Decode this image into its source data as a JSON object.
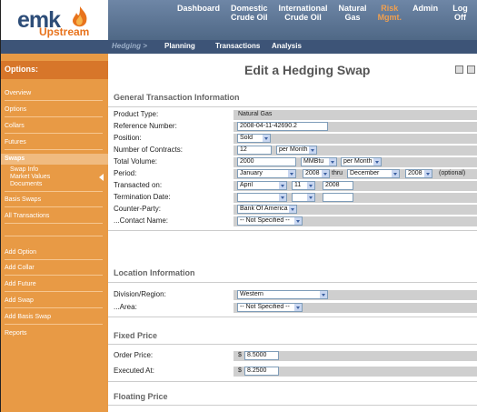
{
  "brand": {
    "name": "emk",
    "sub": "Upstream"
  },
  "topnav": [
    "Dashboard",
    "Domestic\nCrude Oil",
    "International\nCrude Oil",
    "Natural\nGas",
    "Risk\nMgmt.",
    "Admin",
    "Log Off"
  ],
  "subnav": {
    "hedging": "Hedging >",
    "planning": "Planning",
    "transactions": "Transactions",
    "analysis": "Analysis"
  },
  "sidebar": {
    "heading": "Options:",
    "items": [
      "Overview",
      "Options",
      "Collars",
      "Futures",
      "Swaps"
    ],
    "swaps_sub": [
      "Swap Info",
      "Market Values",
      "Documents"
    ],
    "items2": [
      "Basis Swaps",
      "All Transactions"
    ],
    "actions": [
      "Add Option",
      "Add Collar",
      "Add Future",
      "Add Swap",
      "Add Basis Swap",
      "Reports"
    ]
  },
  "page": {
    "title": "Edit a Hedging Swap"
  },
  "general": {
    "heading": "General Transaction Information",
    "product_type_label": "Product Type:",
    "product_type": "Natural Gas",
    "ref_label": "Reference Number:",
    "ref": "2008-04-11-42690.2",
    "position_label": "Position:",
    "position": "Sold",
    "contracts_label": "Number of Contracts:",
    "contracts": "12",
    "contracts_unit": "per Month",
    "volume_label": "Total Volume:",
    "volume": "2000",
    "volume_unit": "MMBtu",
    "volume_per": "per Month",
    "period_label": "Period:",
    "period_from_month": "January",
    "period_from_year": "2008",
    "thru": "thru",
    "period_to_month": "December",
    "period_to_year": "2008",
    "optional": "(optional)",
    "transacted_label": "Transacted on:",
    "transacted_month": "April",
    "transacted_day": "11",
    "transacted_year": "2008",
    "termination_label": "Termination Date:",
    "counterparty_label": "Counter-Party:",
    "counterparty": "Bank Of America",
    "contact_label": "...Contact Name:",
    "contact": "-- Not Specified --"
  },
  "location": {
    "heading": "Location Information",
    "division_label": "Division/Region:",
    "division": "Western",
    "area_label": "...Area:",
    "area": "-- Not Specified --"
  },
  "fixed": {
    "heading": "Fixed Price",
    "order_label": "Order Price:",
    "order": "8.5000",
    "executed_label": "Executed At:",
    "executed": "8.2500",
    "currency": "$"
  },
  "floating": {
    "heading": "Floating Price"
  }
}
